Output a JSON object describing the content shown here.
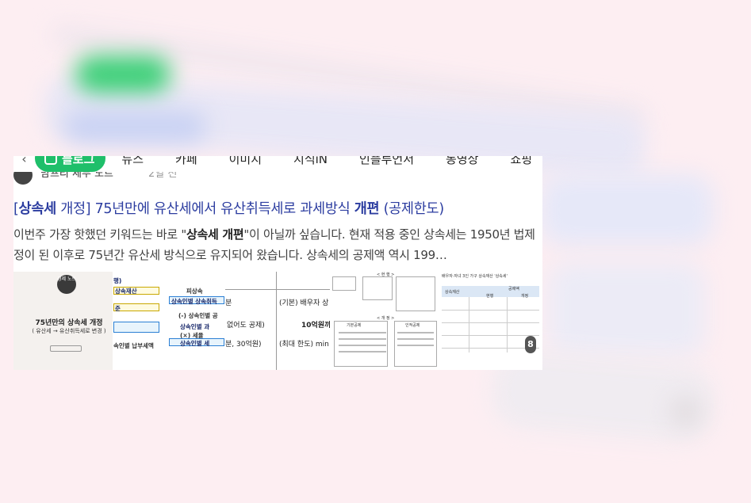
{
  "nav": {
    "prev_arrow": "‹",
    "blog_label": "블로그",
    "tabs": [
      "뉴스",
      "카페",
      "이미지",
      "지식iN",
      "인플루언서",
      "동영상",
      "쇼핑"
    ],
    "next_arrow": "›"
  },
  "author": {
    "name": "맘프리 세무 노트",
    "date": "2일 전"
  },
  "result": {
    "title_bracket_open": "[",
    "title_kw1": "상속세",
    "title_part1": " 개정] 75년만에 유산세에서 유산취득세로 과세방식 ",
    "title_kw2": "개편",
    "title_part2": " (공제한도)",
    "desc_1": "이번주 가장 핫했던 키워드는 바로 \"",
    "desc_kw": "상속세 개편",
    "desc_2": "\"이 아닐까 싶습니다. 현재 적용 중인 상속세는 1950년 법제정이 된 이후로 75년간 유산세 방식으로 유지되어 왔습니다. 상속세의 공제액 역시 199…"
  },
  "thumbs": {
    "t1": {
      "logo": "경제 노트",
      "headline": "75년만의 상속세 개정",
      "subline": "( 유산세 → 유산취득세로 변경 )"
    },
    "t2": {
      "r1": "행)",
      "r2": "상속재산",
      "r3": "피상속",
      "r4": "상속인별 상속취득",
      "r5": "준",
      "r6": "(-) 상속인별 공",
      "r7": "상속인별 과",
      "r8": "(×) 세율",
      "r9": "상속인별 세",
      "r10": "속인별 납부세액"
    },
    "t3": {
      "c1": "(기본) 배우자 상",
      "c2": "분",
      "c3": "없어도 공제)",
      "c4": "10억원까",
      "c5": "분, 30억원)",
      "c6": "(최대 한도) min"
    },
    "t4": {
      "h1": "< 현 행 >",
      "h2": "< 개 정 >",
      "h3": "기본공제",
      "h4": "인적공제"
    },
    "t5": {
      "h1": "배우자·자녀 3인 가구 상속재산 '상속세'",
      "h2": "상속재산",
      "h3": "공제액",
      "h4": "현행",
      "h5": "개정",
      "count": "8"
    }
  }
}
